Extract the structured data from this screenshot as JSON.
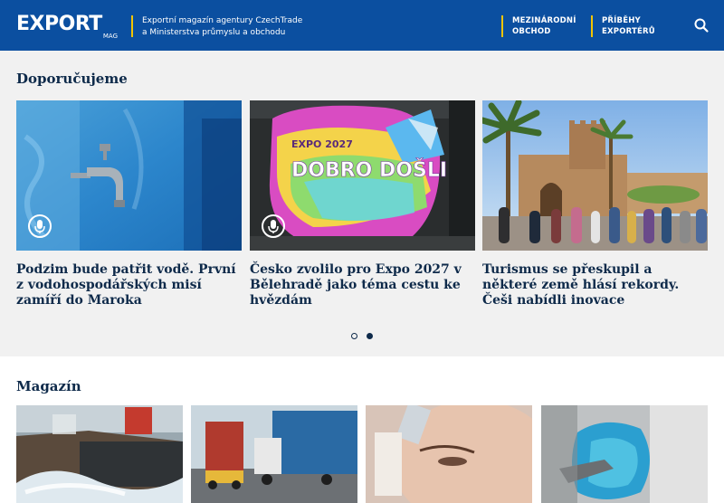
{
  "header": {
    "logo_main": "EXPORT",
    "logo_sub": "MAG",
    "tagline_line1": "Exportní magazín agentury CzechTrade",
    "tagline_line2": "a Ministerstva průmyslu a obchodu",
    "nav": [
      {
        "line1": "MEZINÁRODNÍ",
        "line2": "OBCHOD"
      },
      {
        "line1": "PŘÍBĚHY",
        "line2": "EXPORTÉRŮ"
      }
    ]
  },
  "recommended": {
    "title": "Doporučujeme",
    "cards": [
      {
        "title": "Podzim bude patřit vodě. První z vodohospodářských misí zamíří do Maroka"
      },
      {
        "title": "Česko zvolilo pro Expo 2027 v Bělehradě jako téma cestu ke hvězdám",
        "image_text_1": "EXPO 2027",
        "image_text_2": "DOBRO DOŠLI"
      },
      {
        "title": "Turismus se přeskupil a některé země hlásí rekordy. Češi nabídli inovace"
      }
    ],
    "carousel": {
      "total": 2,
      "active": 2
    }
  },
  "magazine": {
    "title": "Magazín"
  },
  "colors": {
    "header_bg": "#0b4fa0",
    "accent": "#f2c400",
    "heading": "#0e2a4a",
    "section_bg": "#f1f1f1"
  },
  "icons": [
    "search-icon",
    "microphone-icon"
  ]
}
